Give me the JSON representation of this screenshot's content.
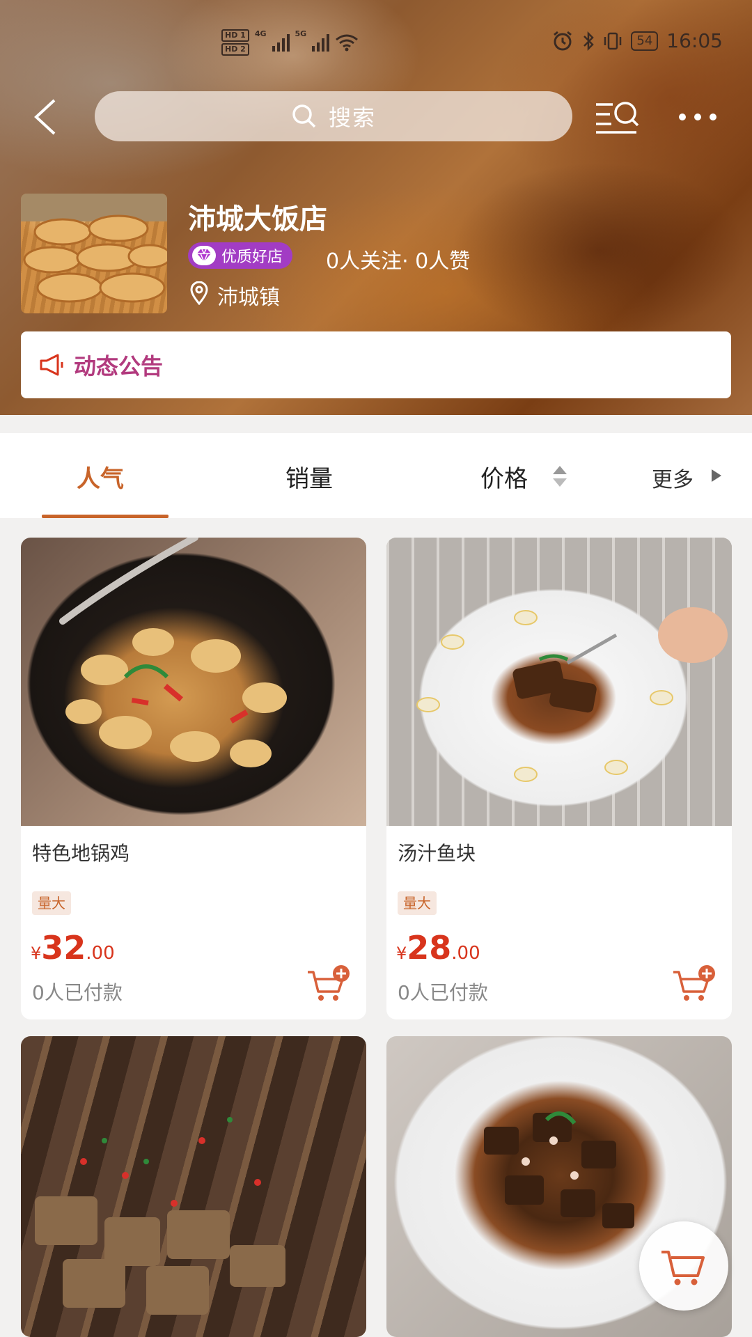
{
  "status_bar": {
    "sim1": "HD 1",
    "sim2": "HD 2",
    "net1": "4G",
    "net2": "5G",
    "battery": "54",
    "time": "16:05"
  },
  "nav": {
    "search_placeholder": "搜索"
  },
  "store": {
    "name": "沛城大饭店",
    "badge": "优质好店",
    "stats": "0人关注· 0人赞",
    "location": "沛城镇",
    "announcement": "动态公告"
  },
  "tabs": {
    "items": [
      "人气",
      "销量",
      "价格"
    ],
    "active": "人气",
    "more": "更多"
  },
  "products": [
    {
      "name": "特色地锅鸡",
      "tag": "量大",
      "currency": "¥",
      "price_int": "32",
      "price_dec": ".00",
      "sold": "0人已付款"
    },
    {
      "name": "汤汁鱼块",
      "tag": "量大",
      "currency": "¥",
      "price_int": "28",
      "price_dec": ".00",
      "sold": "0人已付款"
    }
  ],
  "colors": {
    "accent": "#c8642a",
    "price": "#d8341c",
    "badge": "#a23cc4",
    "announcement": "#b23a7e"
  }
}
